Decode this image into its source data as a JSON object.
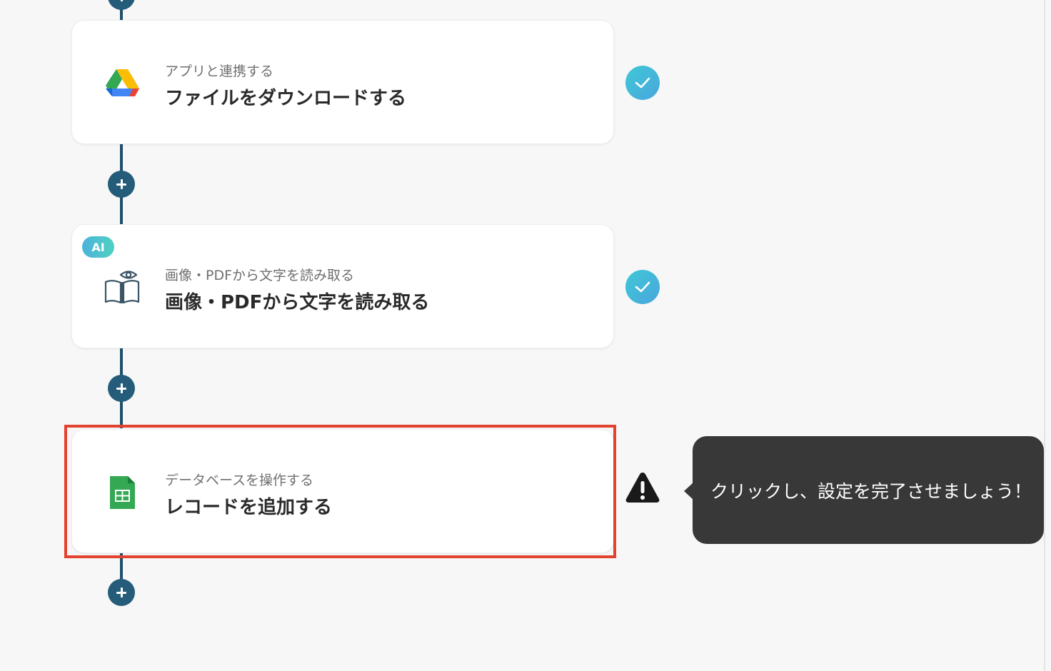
{
  "flow": {
    "steps": [
      {
        "subtitle": "アプリと連携する",
        "title": "ファイルをダウンロードする",
        "icon": "google-drive-icon",
        "status": "completed",
        "status_icon": "check-icon"
      },
      {
        "badge": "AI",
        "subtitle": "画像・PDFから文字を読み取る",
        "title": "画像・PDFから文字を読み取る",
        "icon": "open-book-eye-icon",
        "status": "completed",
        "status_icon": "check-icon"
      },
      {
        "subtitle": "データベースを操作する",
        "title": "レコードを追加する",
        "icon": "google-sheets-icon",
        "status": "incomplete",
        "status_icon": "warning-icon",
        "highlighted": true
      }
    ],
    "add_step_icon": "plus-icon"
  },
  "tooltip": {
    "text": "クリックし、設定を完了させましょう！"
  },
  "colors": {
    "connector": "#1f4f6b",
    "add_button": "#245c7a",
    "check_gradient_start": "#3ec8d6",
    "check_gradient_end": "#4aa6dd",
    "highlight_border": "#e3422e",
    "tooltip_bg": "#383838",
    "background": "#f7f7f7"
  }
}
